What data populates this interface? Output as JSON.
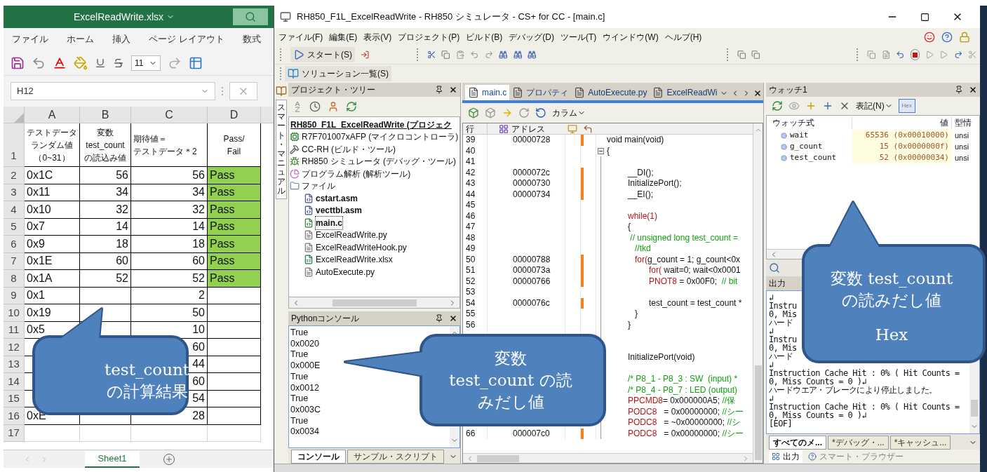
{
  "excel": {
    "title": "ExcelReadWrite.xlsx",
    "ribbon_tabs": [
      "ファイル",
      "ホーム",
      "挿入",
      "ページ レイアウト",
      "数式"
    ],
    "font_size": "11",
    "name_box": "H12",
    "columns": [
      "A",
      "B",
      "C",
      "D"
    ],
    "rows": [
      {
        "num": "1",
        "kind": "header",
        "a": [
          "テストデータ",
          "ランダム値",
          "（0~31）"
        ],
        "b": [
          "変数",
          "test_count",
          "の読込み値"
        ],
        "c": [
          "期待値＝",
          "テストデータ＊2"
        ],
        "d": [
          "Pass/",
          "Fail"
        ],
        "pass": false
      },
      {
        "num": "2",
        "kind": "data",
        "a": "0x1C",
        "b": "56",
        "c": "56",
        "d": "Pass",
        "pass": true
      },
      {
        "num": "3",
        "kind": "data",
        "a": "0x11",
        "b": "34",
        "c": "34",
        "d": "Pass",
        "pass": true
      },
      {
        "num": "4",
        "kind": "data",
        "a": "0x10",
        "b": "32",
        "c": "32",
        "d": "Pass",
        "pass": true
      },
      {
        "num": "5",
        "kind": "data",
        "a": "0x7",
        "b": "14",
        "c": "14",
        "d": "Pass",
        "pass": true
      },
      {
        "num": "6",
        "kind": "data",
        "a": "0x9",
        "b": "18",
        "c": "18",
        "d": "Pass",
        "pass": true
      },
      {
        "num": "7",
        "kind": "data",
        "a": "0x1E",
        "b": "60",
        "c": "60",
        "d": "Pass",
        "pass": true
      },
      {
        "num": "8",
        "kind": "data",
        "a": "0x1A",
        "b": "52",
        "c": "52",
        "d": "Pass",
        "pass": true
      },
      {
        "num": "9",
        "kind": "data",
        "a": "0x1",
        "c": "2",
        "pass": false
      },
      {
        "num": "10",
        "kind": "data",
        "a": "0x19",
        "c": "50",
        "pass": false
      },
      {
        "num": "11",
        "kind": "data",
        "a": "0x5",
        "c": "10",
        "pass": false
      },
      {
        "num": "12",
        "kind": "data",
        "c": "60",
        "pass": false
      },
      {
        "num": "13",
        "kind": "data",
        "c": "44",
        "pass": false
      },
      {
        "num": "14",
        "kind": "data",
        "c": "60",
        "pass": false
      },
      {
        "num": "15",
        "kind": "data",
        "c": "54",
        "pass": false
      },
      {
        "num": "16",
        "kind": "data",
        "a": "0xE",
        "c": "28",
        "pass": false
      },
      {
        "num": "17",
        "kind": "data",
        "pass": false
      }
    ],
    "sheet_tab": "Sheet1"
  },
  "ide": {
    "title": "RH850_F1L_ExcelReadWrite - RH850 シミュレータ - CS+ for CC - [main.c]",
    "menu": [
      "ファイル(F)",
      "編集(E)",
      "表示(V)",
      "プロジェクト(P)",
      "ビルド(B)",
      "デバッグ(D)",
      "ツール(T)",
      "ウインドウ(W)",
      "ヘルプ(H)"
    ],
    "start_button": "スタート(S)",
    "solution_button": "ソリューション一覧(S)",
    "side_tab": "スマート・マニュアル",
    "project_tree": {
      "title": "プロジェクト・ツリー",
      "root": {
        "label": "RH850_F1L_ExcelReadWrite (プロジェク",
        "bold": true,
        "selected": false,
        "children": [
          {
            "label": "R7F701007xAFP (マイクロコントローラ)",
            "kind": "chip",
            "bold": false,
            "selected": false
          },
          {
            "label": "CC-RH (ビルド・ツール)",
            "kind": "tool",
            "bold": false,
            "selected": false
          },
          {
            "label": "RH850 シミュレータ (デバッグ・ツール)",
            "kind": "debugger",
            "bold": false,
            "selected": false
          },
          {
            "label": "プログラム解析 (解析ツール)",
            "kind": "analysis",
            "bold": false,
            "selected": false
          },
          {
            "label": "ファイル",
            "kind": "folder",
            "bold": false,
            "selected": false,
            "children": [
              {
                "label": "cstart.asm",
                "kind": "asm",
                "bold": true,
                "selected": false
              },
              {
                "label": "vecttbl.asm",
                "kind": "asm",
                "bold": true,
                "selected": false
              },
              {
                "label": "main.c",
                "kind": "c",
                "bold": true,
                "selected": true
              },
              {
                "label": "ExcelReadWrite.py",
                "kind": "file",
                "bold": false,
                "selected": false
              },
              {
                "label": "ExcelReadWriteHook.py",
                "kind": "file",
                "bold": false,
                "selected": false
              },
              {
                "label": "ExcelReadWrite.xlsx",
                "kind": "excel",
                "bold": false,
                "selected": false
              },
              {
                "label": "AutoExecute.py",
                "kind": "file",
                "bold": false,
                "selected": false
              }
            ]
          }
        ]
      }
    },
    "python_console": {
      "title": "Pythonコンソール",
      "lines": [
        "True",
        "0x0020",
        "True",
        "0x000E",
        "True",
        "0x0012",
        "True",
        "0x003C",
        "True",
        "0x0034"
      ],
      "tabs": [
        {
          "label": "コンソール",
          "selected": true
        },
        {
          "label": "サンプル・スクリプト",
          "selected": false
        }
      ]
    },
    "editor": {
      "tabs": [
        {
          "label": "main.c",
          "selected": true
        },
        {
          "label": "プロパティ",
          "selected": false
        },
        {
          "label": "AutoExecute.py",
          "selected": false
        },
        {
          "label": "ExcelReadWi",
          "selected": false
        }
      ],
      "column_button": "カラム",
      "headers": {
        "line": "行",
        "address": "アドレス"
      },
      "lines": [
        {
          "num": "39",
          "addr": "00000728",
          "exec": true,
          "code": [
            {
              "text": "void main(void)",
              "kind": "plain"
            }
          ]
        },
        {
          "num": "40",
          "exec": false,
          "fold": true,
          "code": [
            {
              "text": "{",
              "kind": "plain"
            }
          ]
        },
        {
          "num": "41",
          "exec": false
        },
        {
          "num": "42",
          "addr": "0000072c",
          "exec": true,
          "code": [
            {
              "text": "         __DI();",
              "kind": "plain"
            }
          ]
        },
        {
          "num": "43",
          "addr": "00000730",
          "exec": true,
          "code": [
            {
              "text": "         InitializePort();",
              "kind": "plain"
            }
          ]
        },
        {
          "num": "44",
          "addr": "00000734",
          "exec": true,
          "code": [
            {
              "text": "         __EI();",
              "kind": "plain"
            }
          ]
        },
        {
          "num": "45",
          "exec": false
        },
        {
          "num": "46",
          "exec": false,
          "code": [
            {
              "text": "         while(1)",
              "kind": "keyword"
            }
          ]
        },
        {
          "num": "47",
          "exec": false,
          "code": [
            {
              "text": "         {",
              "kind": "plain"
            }
          ]
        },
        {
          "num": "48",
          "exec": false,
          "code": [
            {
              "text": "          // unsigned long test_count =",
              "kind": "comment"
            }
          ]
        },
        {
          "num": "49",
          "exec": false,
          "code": [
            {
              "text": "            //tkd",
              "kind": "comment"
            }
          ]
        },
        {
          "num": "50",
          "addr": "00000788",
          "exec": true,
          "code": [
            {
              "text": "            for(",
              "kind": "keyword"
            },
            {
              "text": "g_count = 1; g_count<0x",
              "kind": "plain"
            }
          ]
        },
        {
          "num": "51",
          "addr": "0000073a",
          "exec": true,
          "code": [
            {
              "text": "                  for(",
              "kind": "keyword"
            },
            {
              "text": " wait=0; wait<0x0001",
              "kind": "plain"
            }
          ]
        },
        {
          "num": "52",
          "addr": "00000766",
          "exec": true,
          "code": [
            {
              "text": "                  PNOT8",
              "kind": "keyword"
            },
            {
              "text": " = 0x00F0;  ",
              "kind": "plain"
            },
            {
              "text": "// bit",
              "kind": "comment"
            }
          ]
        },
        {
          "num": "53",
          "exec": false
        },
        {
          "num": "54",
          "addr": "0000076c",
          "exec": true,
          "code": [
            {
              "text": "                  test_count = test_count *",
              "kind": "plain"
            }
          ]
        },
        {
          "num": "55",
          "exec": false,
          "code": [
            {
              "text": "            }",
              "kind": "plain"
            }
          ]
        },
        {
          "num": "56",
          "exec": false,
          "code": [
            {
              "text": "         }",
              "kind": "plain"
            }
          ]
        }
      ],
      "function_header": {
        "code": [
          {
            "text": "         InitializePort(void)",
            "kind": "plain"
          }
        ]
      },
      "body_lines": [
        {
          "code": [
            {
              "text": "         /* P8_1 - P8_3 : SW  (input) *",
              "kind": "comment"
            }
          ]
        },
        {
          "code": [
            {
              "text": "         /* P8_4 - P8_7 : LED (output)",
              "kind": "comment"
            }
          ]
        },
        {
          "code": [
            {
              "text": "         PPCMD8",
              "kind": "keyword"
            },
            {
              "text": "= 0x000000A5; ",
              "kind": "plain"
            },
            {
              "text": "//保",
              "kind": "comment"
            }
          ]
        },
        {
          "code": [
            {
              "text": "         PODC8",
              "kind": "keyword"
            },
            {
              "text": "   = 0x00000000; ",
              "kind": "plain"
            },
            {
              "text": "//シー",
              "kind": "comment"
            }
          ]
        },
        {
          "code": [
            {
              "text": "         PODC8",
              "kind": "keyword"
            },
            {
              "text": "   = ~0x00000000; ",
              "kind": "plain"
            },
            {
              "text": "//シ",
              "kind": "comment"
            }
          ]
        },
        {
          "num": "66",
          "addr": "000007c0",
          "exec": true,
          "code": [
            {
              "text": "         PODC8",
              "kind": "keyword"
            },
            {
              "text": "   = 0x00000000; ",
              "kind": "plain"
            },
            {
              "text": "//シー",
              "kind": "comment"
            }
          ]
        }
      ]
    },
    "watch": {
      "title": "ウォッチ1",
      "notation_button": "表記(N)",
      "hex_button": "Hex",
      "columns": [
        "ウォッチ式",
        "値",
        "型情"
      ],
      "rows": [
        {
          "name": "wait",
          "value": "65536 (0x00010000)",
          "type": "unsi"
        },
        {
          "name": "g_count",
          "value": "15 (0x0000000f)",
          "type": "unsi"
        },
        {
          "name": "test_count",
          "value": "52 (0x00000034)",
          "type": "unsi"
        }
      ]
    },
    "output": {
      "title": "出力",
      "lines": [
        "↲",
        "Instru",
        "0, Mis",
        "ハード",
        "↲",
        "Instru",
        "0, Mis",
        "ハード",
        "↲",
        "Instruction Cache Hit : 0% ( Hit Counts =",
        "0, Miss Counts = 0 )↲",
        "ハードウエア・ブレークにより停止しました。",
        "↲",
        "Instruction Cache Hit : 0% ( Hit Counts =",
        "0, Miss Counts = 0 )↲",
        "[EOF]"
      ],
      "tabs": [
        {
          "label": "すべてのメ...",
          "selected": true
        },
        {
          "label": "*デバッグ・...",
          "selected": false
        },
        {
          "label": "*キャッシュ...",
          "selected": false
        }
      ],
      "bottom_tabs": [
        {
          "label": "出力",
          "selected": true
        },
        {
          "label": "スマート・ブラウザー",
          "selected": false
        }
      ]
    }
  },
  "callouts": [
    {
      "lines": [
        "test_count",
        "の計算結果"
      ]
    },
    {
      "lines": [
        "変数",
        "test_count  の読",
        "みだし値"
      ]
    },
    {
      "lines": [
        "変数  test_count",
        "の読みだし値",
        "Hex"
      ]
    }
  ]
}
